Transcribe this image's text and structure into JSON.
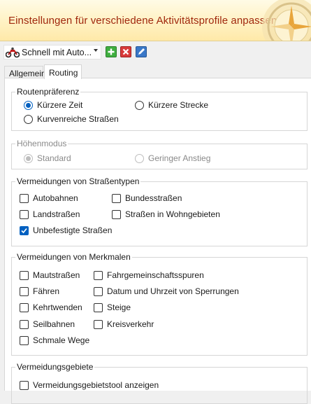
{
  "header": {
    "title": "Einstellungen für verschiedene Aktivitätsprofile anpassen"
  },
  "toolbar": {
    "profile_label": "Schnell mit Auto...",
    "add_icon": "plus-icon",
    "delete_icon": "x-icon",
    "edit_icon": "pencil-icon"
  },
  "tabs": [
    {
      "label": "Allgemein",
      "active": false
    },
    {
      "label": "Routing",
      "active": true
    }
  ],
  "routing": {
    "preference": {
      "legend": "Routenpräferenz",
      "options": [
        {
          "label": "Kürzere Zeit",
          "checked": true
        },
        {
          "label": "Kürzere Strecke",
          "checked": false
        },
        {
          "label": "Kurvenreiche Straßen",
          "checked": false
        }
      ]
    },
    "elevation": {
      "legend": "Höhenmodus",
      "disabled": true,
      "options": [
        {
          "label": "Standard",
          "checked": true
        },
        {
          "label": "Geringer Anstieg",
          "checked": false
        }
      ]
    },
    "road_types": {
      "legend": "Vermeidungen von Straßentypen",
      "items": [
        {
          "label": "Autobahnen",
          "checked": false
        },
        {
          "label": "Bundesstraßen",
          "checked": false
        },
        {
          "label": "Landstraßen",
          "checked": false
        },
        {
          "label": "Straßen in Wohngebieten",
          "checked": false
        },
        {
          "label": "Unbefestigte Straßen",
          "checked": true
        }
      ]
    },
    "features": {
      "legend": "Vermeidungen von Merkmalen",
      "items": [
        {
          "label": "Mautstraßen",
          "checked": false
        },
        {
          "label": "Fahrgemeinschaftsspuren",
          "checked": false
        },
        {
          "label": "Fähren",
          "checked": false
        },
        {
          "label": "Datum und Uhrzeit von Sperrungen",
          "checked": false
        },
        {
          "label": "Kehrtwenden",
          "checked": false
        },
        {
          "label": "Steige",
          "checked": false
        },
        {
          "label": "Seilbahnen",
          "checked": false
        },
        {
          "label": "Kreisverkehr",
          "checked": false
        },
        {
          "label": "Schmale Wege",
          "checked": false
        }
      ]
    },
    "areas": {
      "legend": "Vermeidungsgebiete",
      "items": [
        {
          "label": "Vermeidungsgebietstool anzeigen",
          "checked": false
        }
      ]
    }
  },
  "colors": {
    "accent": "#0060c0",
    "header_text": "#a0280d"
  }
}
